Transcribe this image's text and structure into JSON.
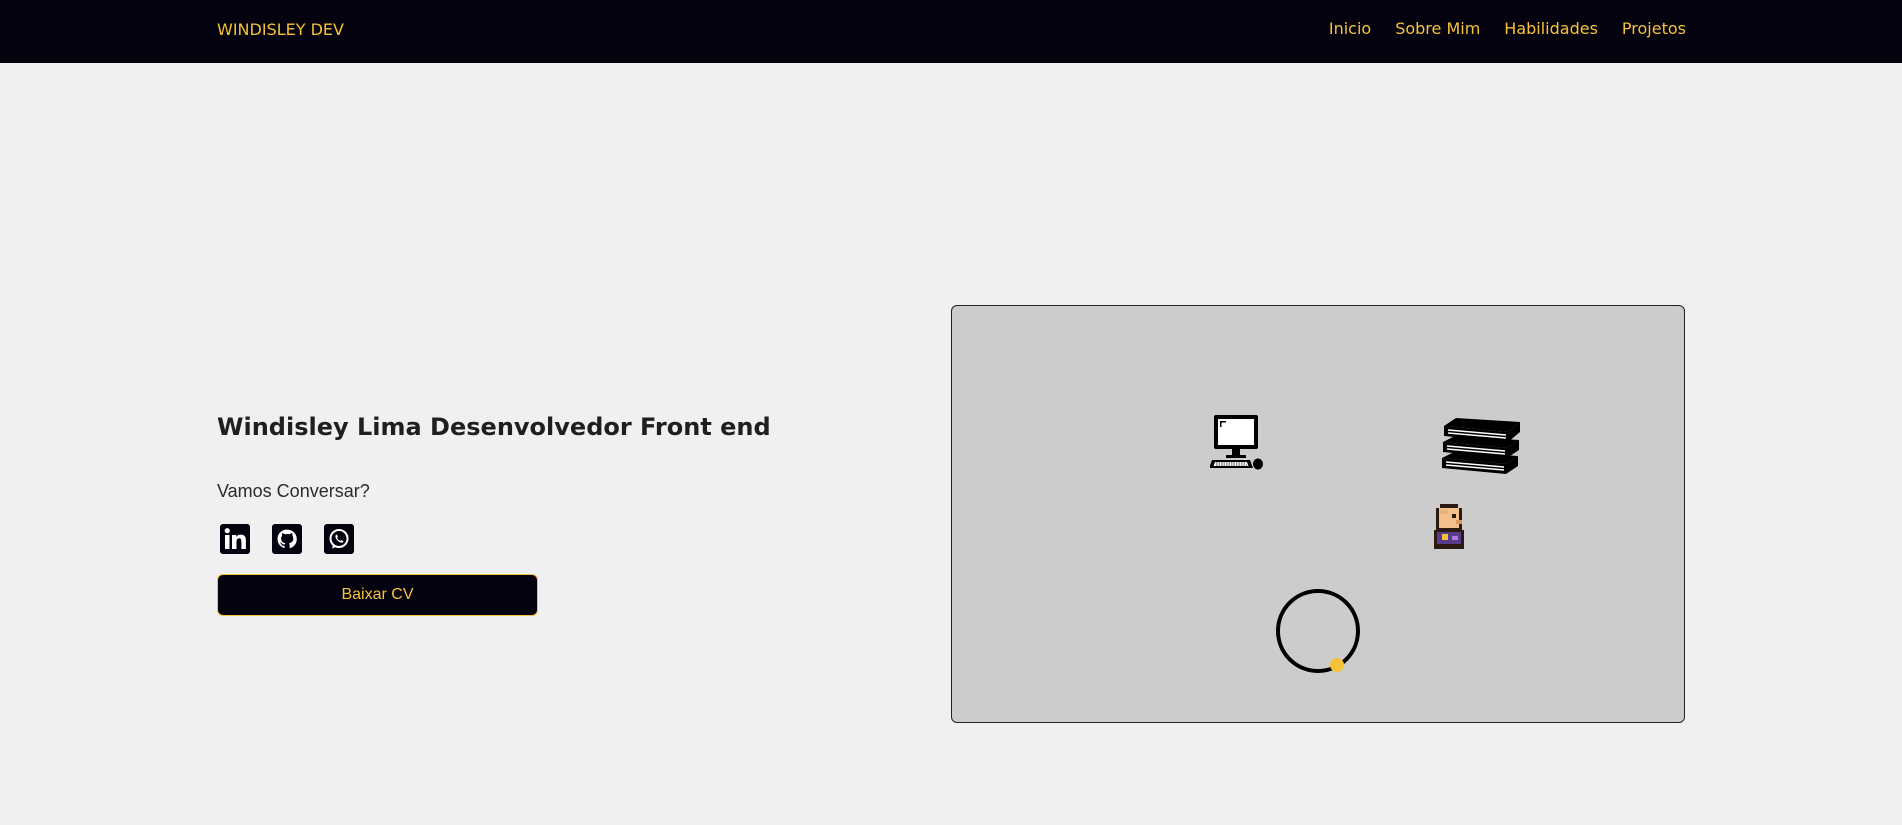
{
  "navbar": {
    "brand": "WINDISLEY DEV",
    "links": [
      {
        "label": "Inicio"
      },
      {
        "label": "Sobre Mim"
      },
      {
        "label": "Habilidades"
      },
      {
        "label": "Projetos"
      }
    ]
  },
  "hero": {
    "title": "Windisley Lima Desenvolvedor Front end",
    "subtitle": "Vamos Conversar?",
    "social_icons": [
      "linkedin-icon",
      "github-icon",
      "whatsapp-icon"
    ],
    "cv_button": "Baixar CV"
  },
  "scene": {
    "items": [
      "computer-icon",
      "books-icon",
      "character-sprite",
      "loading-ring"
    ]
  },
  "colors": {
    "accent": "#f5c23a",
    "nav_bg": "#05020f",
    "page_bg": "#f0f0f0",
    "scene_bg": "#cccccc"
  }
}
